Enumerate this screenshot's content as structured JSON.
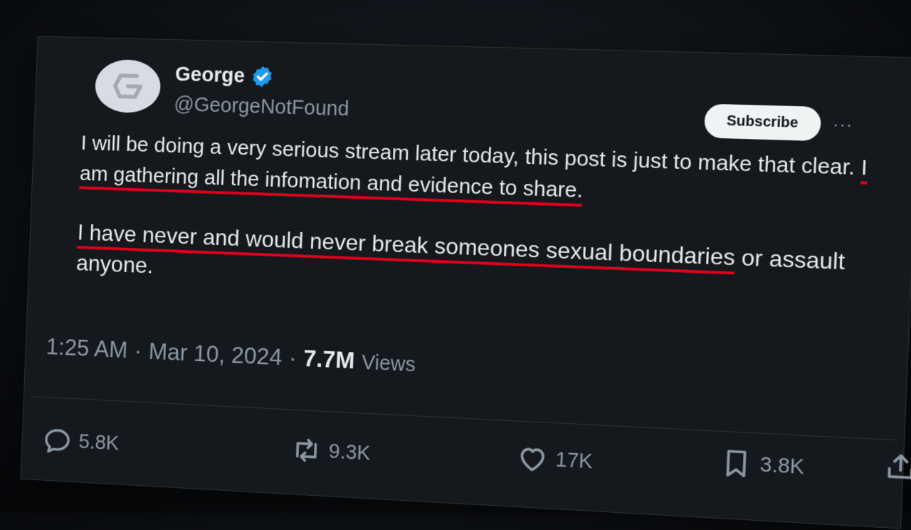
{
  "author": {
    "name": "George",
    "handle": "@GeorgeNotFound"
  },
  "subscribe_label": "Subscribe",
  "more_label": "···",
  "tweet": {
    "p1_a": "I will be doing a very serious stream later today, this post is just to make that clear. ",
    "p1_b": "I am gathering all the infomation and evidence to share.",
    "p2_a": "I have never and would never break someones sexual boundaries",
    "p2_b": " or assault anyone."
  },
  "meta": {
    "time": "1:25 AM",
    "sep1": "·",
    "date": "Mar 10, 2024",
    "sep2": "·",
    "views_count": "7.7M",
    "views_label": "Views"
  },
  "actions": {
    "replies": "5.8K",
    "reposts": "9.3K",
    "likes": "17K",
    "bookmarks": "3.8K"
  },
  "colors": {
    "background": "#15181c",
    "accent_blue": "#1d9bf0",
    "highlight_red": "#e0001b",
    "text_primary": "#e7e9ea",
    "text_secondary": "#8b98a5"
  },
  "icons": [
    "verified-badge-icon",
    "reply-icon",
    "repost-icon",
    "like-icon",
    "bookmark-icon",
    "share-icon"
  ]
}
